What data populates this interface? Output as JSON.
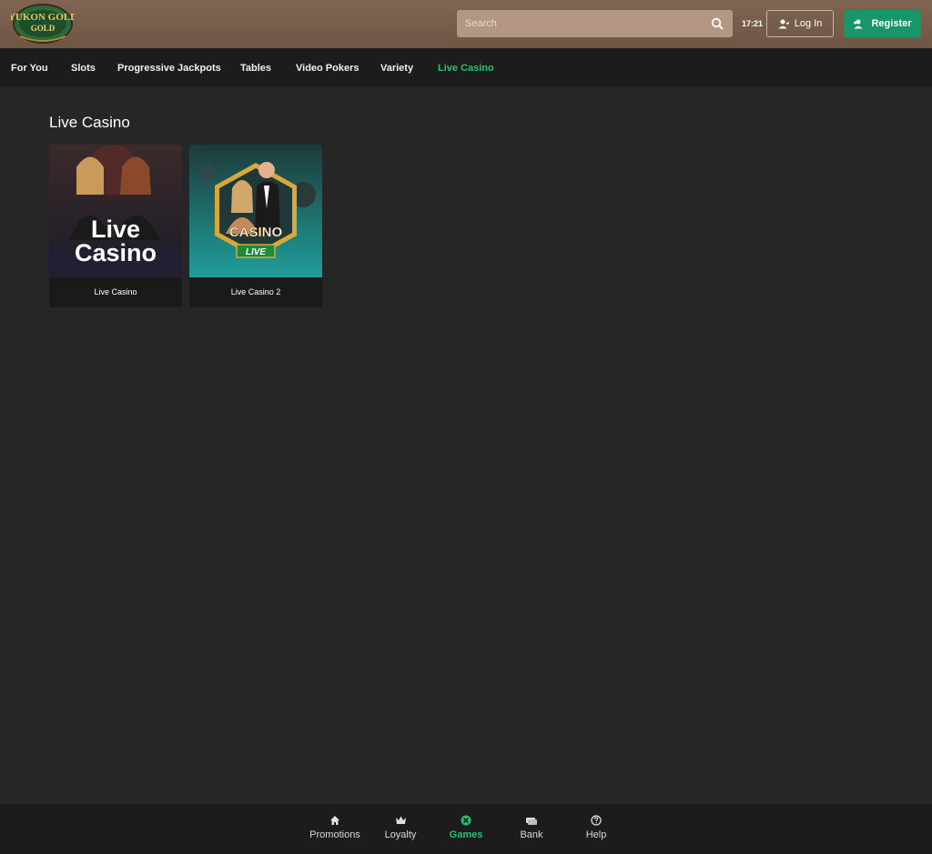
{
  "header": {
    "logo_icon": "yukon-gold-casino-logo",
    "logo_text": "YUKON GOLD",
    "search_placeholder": "Search",
    "time": "17:21",
    "login_label": "Log In",
    "register_label": "Register",
    "colors": {
      "header": "#7f6451",
      "search": "#b39782",
      "register": "#17966a"
    }
  },
  "nav": {
    "items": [
      {
        "label": "For You"
      },
      {
        "label": "Slots"
      },
      {
        "label": "Progressive Jackpots"
      },
      {
        "label": "Tables"
      },
      {
        "label": "Video Pokers"
      },
      {
        "label": "Variety"
      },
      {
        "label": "Live Casino",
        "active": true
      }
    ],
    "active_color": "#22c46c"
  },
  "main": {
    "title": "Live Casino",
    "games": [
      {
        "name": "Live Casino",
        "thumb_text_1": "Live",
        "thumb_text_2": "Casino"
      },
      {
        "name": "Live Casino 2",
        "thumb_text_1": "CASINO",
        "thumb_text_2": "LIVE"
      }
    ]
  },
  "bottom_nav": {
    "items": [
      {
        "label": "Promotions",
        "icon": "home-icon"
      },
      {
        "label": "Loyalty",
        "icon": "crown-icon"
      },
      {
        "label": "Games",
        "icon": "games-icon",
        "active": true
      },
      {
        "label": "Bank",
        "icon": "bank-icon"
      },
      {
        "label": "Help",
        "icon": "help-icon"
      }
    ]
  }
}
